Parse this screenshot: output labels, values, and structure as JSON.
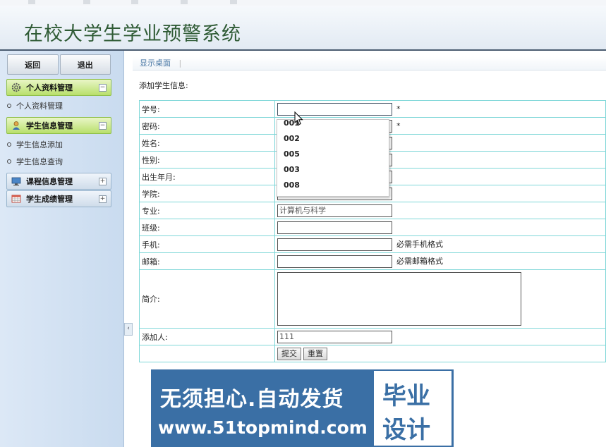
{
  "header": {
    "title": "在校大学生学业预警系统"
  },
  "sidebar": {
    "back_label": "返回",
    "exit_label": "退出",
    "groups": [
      {
        "label": "个人资料管理",
        "toggle": "−",
        "items": [
          "个人资料管理"
        ]
      },
      {
        "label": "学生信息管理",
        "toggle": "−",
        "items": [
          "学生信息添加",
          "学生信息查询"
        ]
      },
      {
        "label": "课程信息管理",
        "toggle": "+"
      },
      {
        "label": "学生成绩管理",
        "toggle": "+"
      }
    ],
    "collapse_glyph": "‹"
  },
  "breadcrumb": {
    "label": "显示桌面",
    "sep": "|"
  },
  "form": {
    "section_title": "添加学生信息:",
    "labels": {
      "student_id": "学号:",
      "password": "密码:",
      "name": "姓名:",
      "gender": "性别:",
      "birth": "出生年月:",
      "college": "学院:",
      "major": "专业:",
      "class": "班级:",
      "phone": "手机:",
      "email": "邮箱:",
      "intro": "简介:",
      "adder": "添加人:"
    },
    "values": {
      "student_id": "",
      "major": "计算机与科学",
      "adder": "111"
    },
    "required_mark": "*",
    "phone_hint": "必需手机格式",
    "email_hint": "必需邮箱格式",
    "submit_label": "提交",
    "reset_label": "重置"
  },
  "autocomplete": {
    "options": [
      "001",
      "002",
      "005",
      "003",
      "008"
    ]
  },
  "banner": {
    "line1": "无须担心.自动发货",
    "line2": "www.51topmind.com",
    "badge_line1": "毕业",
    "badge_line2": "设计"
  }
}
